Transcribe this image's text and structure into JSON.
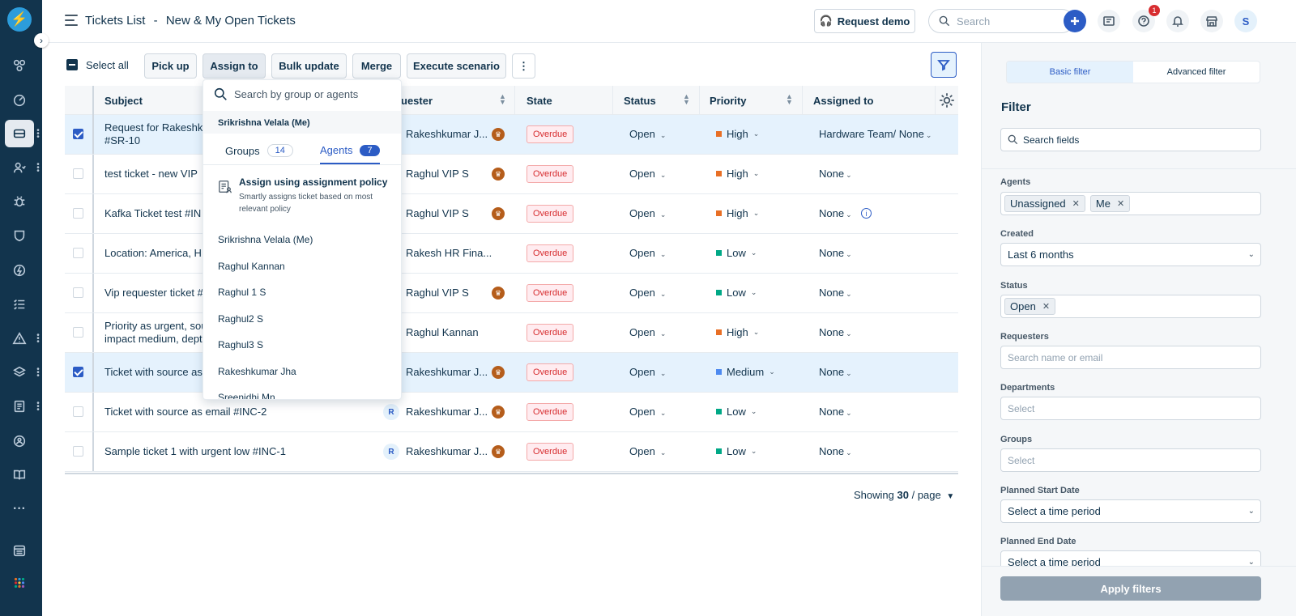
{
  "header": {
    "title": "Tickets List",
    "separator": "-",
    "view_name": "New & My Open Tickets",
    "request_demo": "Request demo",
    "search_placeholder": "Search",
    "notifications_count": "1",
    "user_initial": "S"
  },
  "toolbar": {
    "select_all": "Select all",
    "pick_up": "Pick up",
    "assign_to": "Assign to",
    "bulk_update": "Bulk update",
    "merge": "Merge",
    "execute_scenario": "Execute scenario",
    "more": "⋮"
  },
  "columns": {
    "subject": "Subject",
    "requester": "uester",
    "state": "State",
    "status": "Status",
    "priority": "Priority",
    "assigned_to": "Assigned to"
  },
  "rows": [
    {
      "subject": "Request for Rakeshku",
      "subject2": "#SR-10",
      "avatar": "",
      "requester": "Rakeshkumar J...",
      "vip": true,
      "state": "Overdue",
      "status": "Open",
      "priority": "High",
      "priority_color": "#e86f25",
      "assigned": "Hardware Team/ None",
      "selected": true,
      "info": false
    },
    {
      "subject": "test ticket - new VIP",
      "subject2": "",
      "avatar": "",
      "requester": "Raghul VIP S",
      "vip": true,
      "state": "Overdue",
      "status": "Open",
      "priority": "High",
      "priority_color": "#e86f25",
      "assigned": "None",
      "selected": false,
      "info": false
    },
    {
      "subject": "Kafka Ticket test  #IN",
      "subject2": "",
      "avatar": "",
      "requester": "Raghul VIP S",
      "vip": true,
      "state": "Overdue",
      "status": "Open",
      "priority": "High",
      "priority_color": "#e86f25",
      "assigned": "None",
      "selected": false,
      "info": true
    },
    {
      "subject": "Location: America, HF",
      "subject2": "",
      "avatar": "",
      "requester": "Rakesh HR Fina...",
      "vip": false,
      "state": "Overdue",
      "status": "Open",
      "priority": "Low",
      "priority_color": "#00a886",
      "assigned": "None",
      "selected": false,
      "info": false
    },
    {
      "subject": "Vip requester ticket  #",
      "subject2": "",
      "avatar": "",
      "requester": "Raghul VIP S",
      "vip": true,
      "state": "Overdue",
      "status": "Open",
      "priority": "Low",
      "priority_color": "#00a886",
      "assigned": "None",
      "selected": false,
      "info": false
    },
    {
      "subject": "Priority as urgent, sou",
      "subject2": "impact medium, dept",
      "avatar": "",
      "requester": "Raghul Kannan",
      "vip": false,
      "state": "Overdue",
      "status": "Open",
      "priority": "High",
      "priority_color": "#e86f25",
      "assigned": "None",
      "selected": false,
      "info": false
    },
    {
      "subject": "Ticket with source as",
      "subject2": "",
      "avatar": "",
      "requester": "Rakeshkumar J...",
      "vip": true,
      "state": "Overdue",
      "status": "Open",
      "priority": "Medium",
      "priority_color": "#4d8af0",
      "assigned": "None",
      "selected": true,
      "info": false
    },
    {
      "subject": "Ticket with source as email  #INC-2",
      "subject2": "",
      "avatar": "R",
      "requester": "Rakeshkumar J...",
      "vip": true,
      "state": "Overdue",
      "status": "Open",
      "priority": "Low",
      "priority_color": "#00a886",
      "assigned": "None",
      "selected": false,
      "info": false
    },
    {
      "subject": "Sample ticket 1 with urgent low  #INC-1",
      "subject2": "",
      "avatar": "R",
      "requester": "Rakeshkumar J...",
      "vip": true,
      "state": "Overdue",
      "status": "Open",
      "priority": "Low",
      "priority_color": "#00a886",
      "assigned": "None",
      "selected": false,
      "info": false
    }
  ],
  "pagination": {
    "prefix": "Showing",
    "count": "30",
    "suffix": "/ page"
  },
  "assign_dropdown": {
    "search_placeholder": "Search by group or agents",
    "current_user": "Srikrishna Velala (Me)",
    "groups_tab": "Groups",
    "groups_count": "14",
    "agents_tab": "Agents",
    "agents_count": "7",
    "policy_title": "Assign using assignment policy",
    "policy_desc": "Smartly assigns ticket based on most relevant policy",
    "agents": [
      "Srikrishna Velala (Me)",
      "Raghul Kannan",
      "Raghul 1 S",
      "Raghul2 S",
      "Raghul3 S",
      "Rakeshkumar Jha",
      "Sreenidhi Mn"
    ]
  },
  "filter_panel": {
    "basic_tab": "Basic filter",
    "advanced_tab": "Advanced filter",
    "title": "Filter",
    "search_placeholder": "Search fields",
    "agents_label": "Agents",
    "agents_tags": [
      "Unassigned",
      "Me"
    ],
    "created_label": "Created",
    "created_value": "Last 6 months",
    "status_label": "Status",
    "status_tags": [
      "Open"
    ],
    "requesters_label": "Requesters",
    "requesters_placeholder": "Search name or email",
    "departments_label": "Departments",
    "departments_placeholder": "Select",
    "groups_label": "Groups",
    "groups_placeholder": "Select",
    "planned_start_label": "Planned Start Date",
    "planned_start_value": "Select a time period",
    "planned_end_label": "Planned End Date",
    "planned_end_value": "Select a time period",
    "apply": "Apply filters"
  },
  "colors": {
    "primary": "#2c5cc5",
    "sidebar": "#12344d",
    "overdue": "#d72d30",
    "highlight": "#d72d30"
  }
}
